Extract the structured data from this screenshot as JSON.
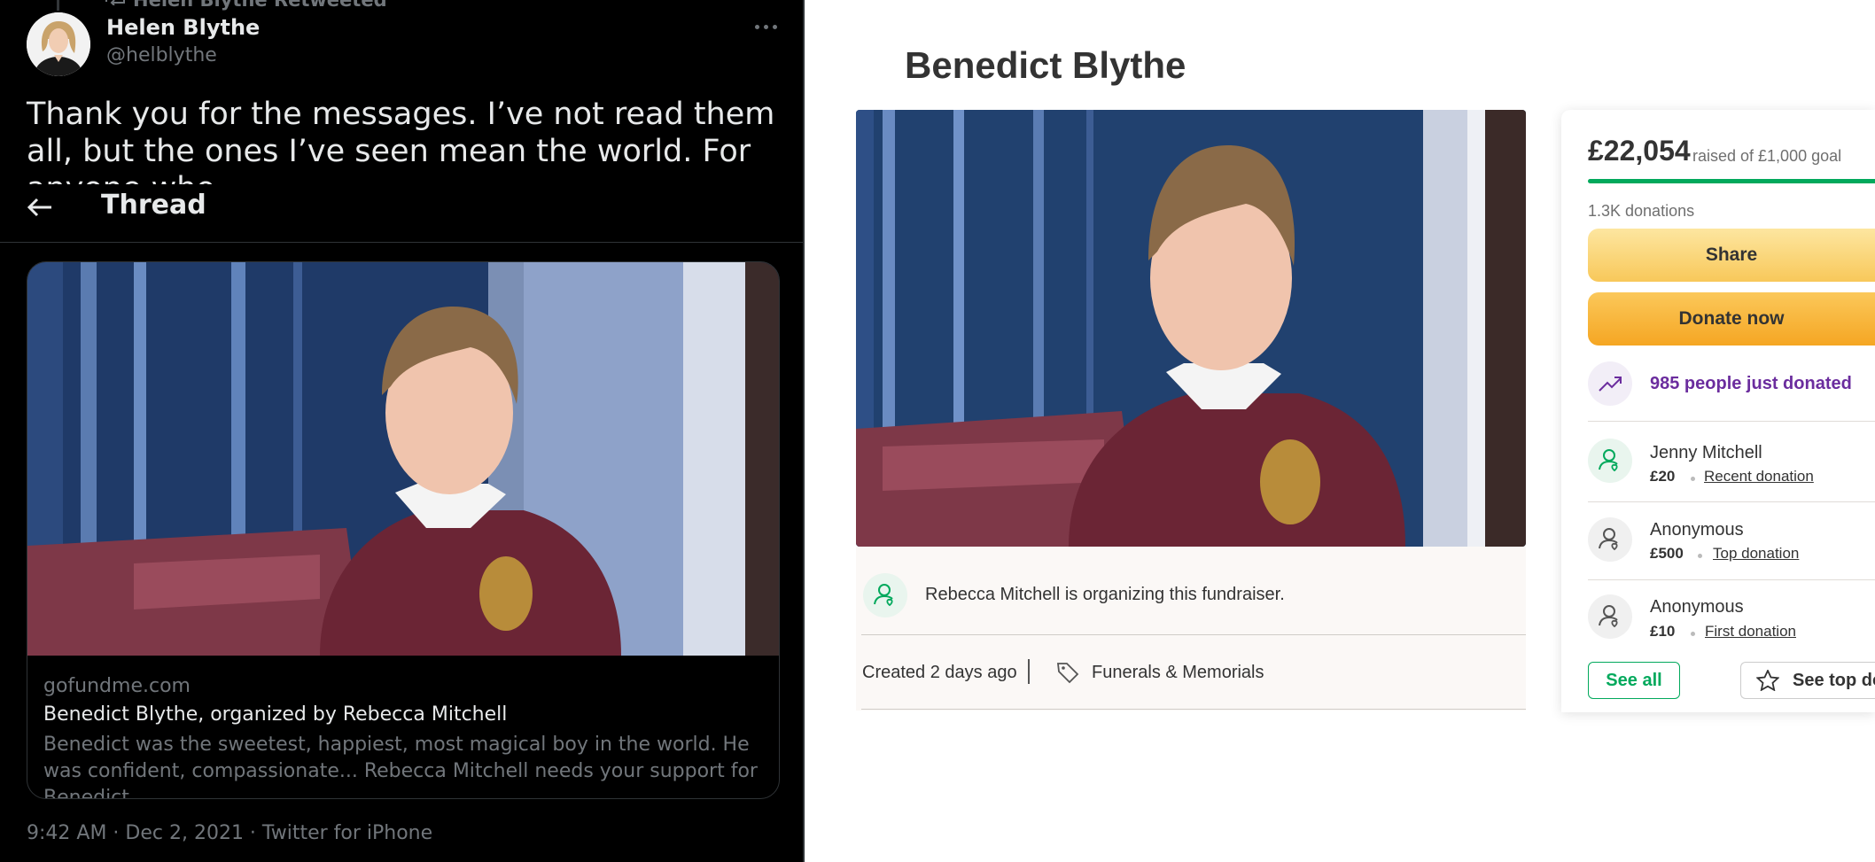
{
  "twitter": {
    "retweet_text": "Helen Blythe Retweeted",
    "author_name": "Helen Blythe",
    "author_handle": "@helblythe",
    "tweet_text": "Thank you for the messages. I’ve not read them all, but the ones I’ve seen mean the world. For anyone who",
    "thread_title": "Thread",
    "card": {
      "domain": "gofundme.com",
      "title": "Benedict Blythe, organized by Rebecca Mitchell",
      "description": "Benedict was the sweetest, happiest, most magical boy in the world. He was confident, compassionate... Rebecca Mitchell needs your support for Benedict ..."
    },
    "timestamp": "9:42 AM · Dec 2, 2021 · Twitter for iPhone"
  },
  "gofundme": {
    "campaign_title": "Benedict Blythe",
    "organizer_text": "Rebecca Mitchell is organizing this fundraiser.",
    "created": "Created 2 days ago",
    "category": "Funerals & Memorials",
    "amount_raised": "£22,054",
    "goal_text": "raised of £1,000 goal",
    "progress_fraction": 1.0,
    "donations_count": "1.3K donations",
    "share_label": "Share",
    "donate_label": "Donate now",
    "just_donated": "985 people just donated",
    "donors": [
      {
        "name": "Jenny Mitchell",
        "amount": "£20",
        "type": "Recent donation"
      },
      {
        "name": "Anonymous",
        "amount": "£500",
        "type": "Top donation"
      },
      {
        "name": "Anonymous",
        "amount": "£10",
        "type": "First donation"
      }
    ],
    "see_all_label": "See all",
    "see_top_label": "See top donations",
    "colors": {
      "brand_green": "#02a95c",
      "accent_purple": "#6b2d9e",
      "button_orange": "#f5a623"
    }
  }
}
